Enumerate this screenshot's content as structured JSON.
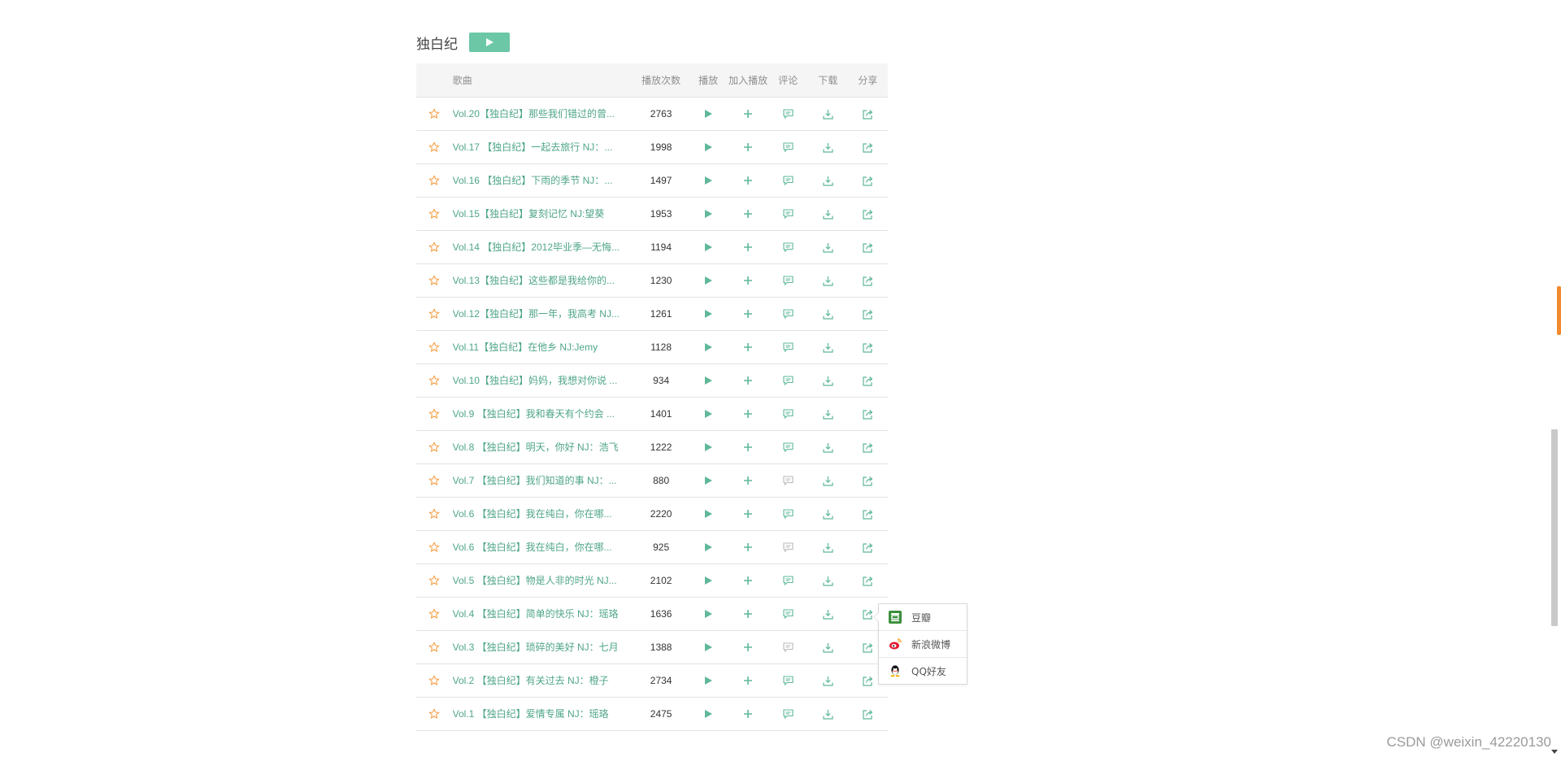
{
  "section": {
    "title": "独白纪"
  },
  "table": {
    "headers": {
      "song": "歌曲",
      "plays": "播放次数",
      "play": "播放",
      "add": "加入播放",
      "comment": "评论",
      "download": "下载",
      "share": "分享"
    },
    "rows": [
      {
        "title": "Vol.20【独白纪】那些我们错过的曾...",
        "plays": "2763",
        "comment_active": true
      },
      {
        "title": "Vol.17 【独白纪】一起去旅行 NJ：...",
        "plays": "1998",
        "comment_active": true
      },
      {
        "title": "Vol.16 【独白纪】下雨的季节 NJ：...",
        "plays": "1497",
        "comment_active": true
      },
      {
        "title": "Vol.15【独白纪】复刻记忆 NJ:望葵",
        "plays": "1953",
        "comment_active": true
      },
      {
        "title": "Vol.14 【独白纪】2012毕业季—无悔...",
        "plays": "1194",
        "comment_active": true
      },
      {
        "title": "Vol.13【独白纪】这些都是我给你的...",
        "plays": "1230",
        "comment_active": true
      },
      {
        "title": "Vol.12【独白纪】那一年，我高考 NJ...",
        "plays": "1261",
        "comment_active": true
      },
      {
        "title": "Vol.11【独白纪】在他乡 NJ:Jemy",
        "plays": "1128",
        "comment_active": true
      },
      {
        "title": "Vol.10【独白纪】妈妈，我想对你说 ...",
        "plays": "934",
        "comment_active": true
      },
      {
        "title": "Vol.9 【独白纪】我和春天有个约会 ...",
        "plays": "1401",
        "comment_active": true
      },
      {
        "title": "Vol.8 【独白纪】明天，你好 NJ：浩飞",
        "plays": "1222",
        "comment_active": true
      },
      {
        "title": "Vol.7 【独白纪】我们知道的事 NJ：...",
        "plays": "880",
        "comment_active": false
      },
      {
        "title": "Vol.6 【独白纪】我在纯白，你在哪...",
        "plays": "2220",
        "comment_active": true
      },
      {
        "title": "Vol.6 【独白纪】我在纯白，你在哪...",
        "plays": "925",
        "comment_active": false
      },
      {
        "title": "Vol.5 【独白纪】物是人非的时光 NJ...",
        "plays": "2102",
        "comment_active": true
      },
      {
        "title": "Vol.4 【独白纪】简单的快乐 NJ：瑶珞",
        "plays": "1636",
        "comment_active": true
      },
      {
        "title": "Vol.3 【独白纪】琐碎的美好 NJ：七月",
        "plays": "1388",
        "comment_active": false
      },
      {
        "title": "Vol.2 【独白纪】有关过去 NJ：橙子",
        "plays": "2734",
        "comment_active": true
      },
      {
        "title": "Vol.1 【独白纪】爱情专属 NJ：瑶珞",
        "plays": "2475",
        "comment_active": true
      }
    ]
  },
  "share_popup": {
    "items": [
      {
        "label": "豆瓣",
        "icon": "douban-icon"
      },
      {
        "label": "新浪微博",
        "icon": "weibo-icon"
      },
      {
        "label": "QQ好友",
        "icon": "qq-icon"
      }
    ]
  },
  "watermark": "CSDN @weixin_42220130",
  "colors": {
    "accent": "#5fb898",
    "star": "#f5a24b",
    "title_link": "#4fa58a"
  }
}
